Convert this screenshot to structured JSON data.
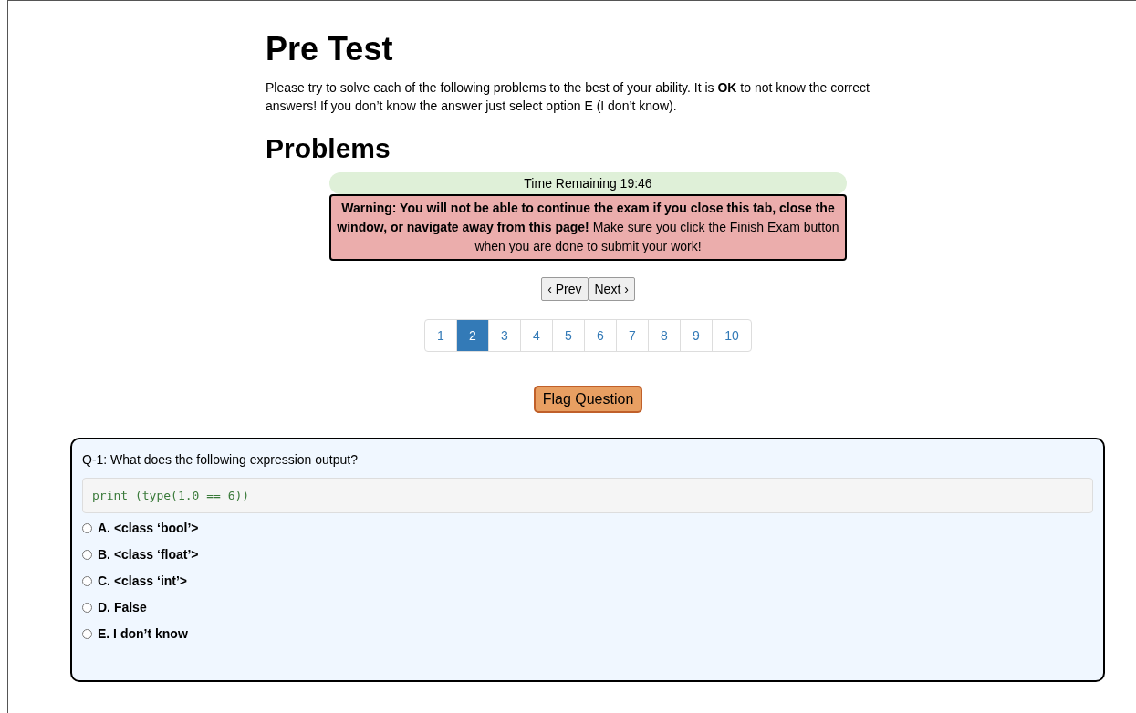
{
  "title": "Pre Test",
  "intro": "Please try to solve each of the following problems to the best of your ability. It is **OK** to not know the correct answers! If you don’t know the answer just select option E (I don’t know).",
  "section_title": "Problems",
  "timer": "Time Remaining 19:46",
  "warning": "**Warning: You will not be able to continue the exam if you close this tab, close the window, or navigate away from this page!** Make sure you click the Finish Exam button when you are done to submit your work!",
  "nav_buttons": [
    "‹ Prev",
    "Next ›"
  ],
  "pages": [
    {
      "label": "1",
      "selected": false
    },
    {
      "label": "2",
      "selected": true
    },
    {
      "label": "3",
      "selected": false
    },
    {
      "label": "4",
      "selected": false
    },
    {
      "label": "5",
      "selected": false
    },
    {
      "label": "6",
      "selected": false
    },
    {
      "label": "7",
      "selected": false
    },
    {
      "label": "8",
      "selected": false
    },
    {
      "label": "9",
      "selected": false
    },
    {
      "label": "10",
      "selected": false
    }
  ],
  "flag_button": "Flag Question",
  "question": {
    "prompt": "Q-1: What does the following expression output?",
    "code": "print (type(1.0 == 6))",
    "options": [
      {
        "label": "A. <class ‘bool’>",
        "selected": false
      },
      {
        "label": "B. <class ‘float’>",
        "selected": false
      },
      {
        "label": "C. <class ‘int’>",
        "selected": false
      },
      {
        "label": "D. False",
        "selected": false
      },
      {
        "label": "E. I don’t know",
        "selected": false
      }
    ]
  }
}
